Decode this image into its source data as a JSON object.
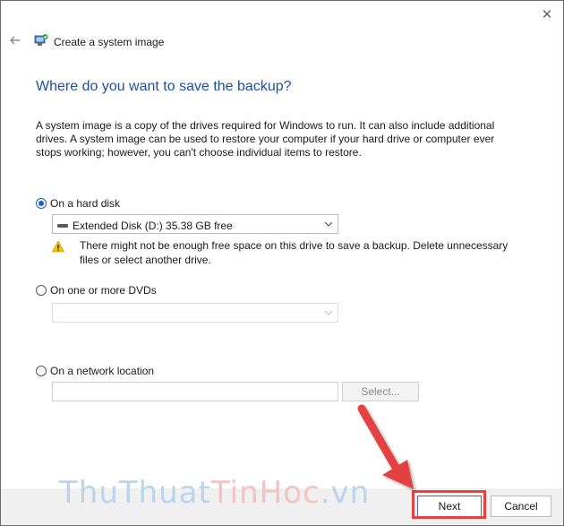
{
  "window": {
    "title": "Create a system image",
    "close_glyph": "✕",
    "back_glyph": "←"
  },
  "page": {
    "heading": "Where do you want to save the backup?",
    "description": "A system image is a copy of the drives required for Windows to run. It can also include additional drives. A system image can be used to restore your computer if your hard drive or computer ever stops working; however, you can't choose individual items to restore."
  },
  "options": {
    "hard_disk": {
      "label": "On a hard disk",
      "selected": true,
      "drive_value": "Extended Disk (D:)  35.38 GB free",
      "warning": "There might not be enough free space on this drive to save a backup. Delete unnecessary files or select another drive."
    },
    "dvd": {
      "label": "On one or more DVDs",
      "selected": false,
      "drive_value": ""
    },
    "network": {
      "label": "On a network location",
      "selected": false,
      "path_value": "",
      "select_label": "Select..."
    }
  },
  "footer": {
    "next_label": "Next",
    "cancel_label": "Cancel"
  },
  "watermark": {
    "part1": "ThuThuat",
    "part2": "TinHoc",
    "part3": ".vn"
  },
  "colors": {
    "heading": "#1f4e9c",
    "radio_selected": "#1a5fc4",
    "highlight": "#e44343",
    "warning": "#f5c400"
  },
  "icons": {
    "back": "arrow-left-icon",
    "header": "system-image-icon",
    "drive": "hard-drive-icon",
    "warning": "warning-triangle-icon",
    "close": "close-icon"
  }
}
